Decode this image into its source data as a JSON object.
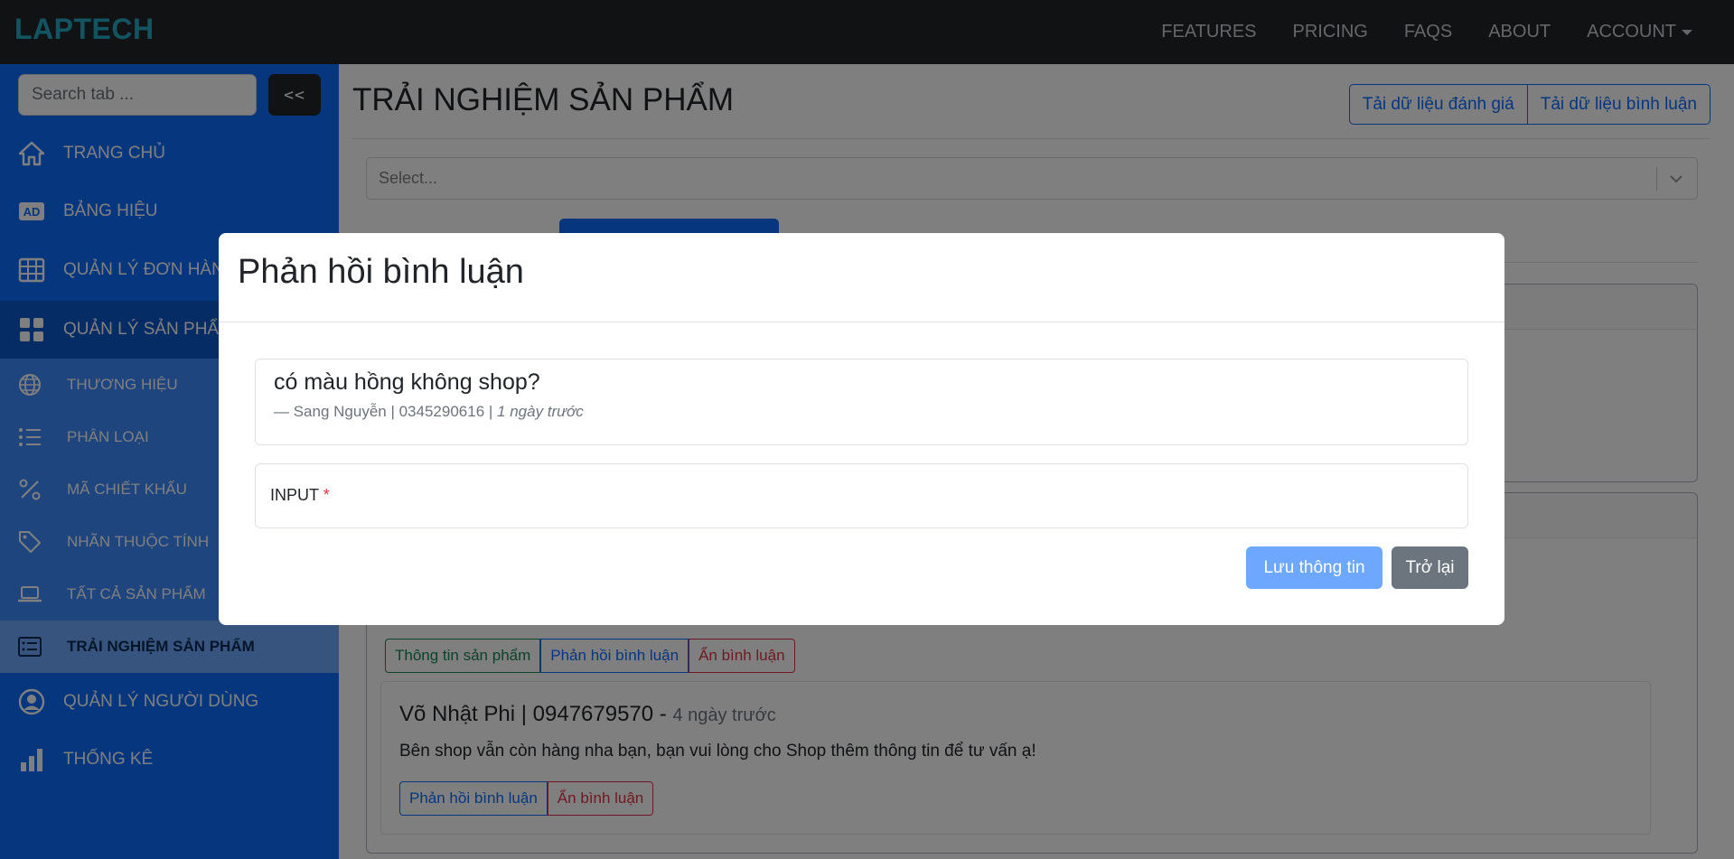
{
  "navbar": {
    "brand": "LAPTECH",
    "links": [
      "FEATURES",
      "PRICING",
      "FAQS",
      "ABOUT",
      "ACCOUNT"
    ]
  },
  "sidebar": {
    "search_placeholder": "Search tab ...",
    "collapse_label": "<<",
    "items": [
      {
        "label": "TRANG CHỦ",
        "icon": "home-icon"
      },
      {
        "label": "BẢNG HIỆU",
        "icon": "ad-icon"
      },
      {
        "label": "QUẢN LÝ ĐƠN HÀNG",
        "icon": "table-icon"
      },
      {
        "label": "QUẢN LÝ SẢN PHẨM",
        "icon": "grid-icon"
      }
    ],
    "sub_items": [
      {
        "label": "THƯƠNG HIỆU",
        "icon": "globe-icon"
      },
      {
        "label": "PHÂN LOẠI",
        "icon": "list-icon"
      },
      {
        "label": "MÃ CHIẾT KHẤU",
        "icon": "percent-icon"
      },
      {
        "label": "NHÃN THUỘC TÍNH",
        "icon": "tag-icon"
      },
      {
        "label": "TẤT CẢ SẢN PHẨM",
        "icon": "laptop-icon"
      },
      {
        "label": "TRẢI NGHIỆM SẢN PHẨM",
        "icon": "card-list-icon"
      }
    ],
    "bottom_items": [
      {
        "label": "QUẢN LÝ NGƯỜI DÙNG",
        "icon": "user-circle-icon"
      },
      {
        "label": "THỐNG KÊ",
        "icon": "bar-chart-icon"
      }
    ]
  },
  "main": {
    "title": "TRẢI NGHIỆM SẢN PHẨM",
    "load_review_data": "Tải dữ liệu đánh giá",
    "load_comment_data": "Tải dữ liệu bình luận",
    "select_placeholder": "Select...",
    "comment_actions": {
      "product_info": "Thông tin sản phẩm",
      "reply": "Phản hồi bình luận",
      "hide": "Ẩn bình luận"
    },
    "reply": {
      "author": "Võ Nhật Phi | 0947679570 -",
      "time": "4 ngày trước",
      "text": "Bên shop vẫn còn hàng nha bạn, bạn vui lòng cho Shop thêm thông tin để tư vấn ạ!",
      "reply_label": "Phản hồi bình luận",
      "hide_label": "Ẩn bình luận"
    }
  },
  "modal": {
    "title": "Phản hồi bình luận",
    "comment": "có màu hồng không shop?",
    "footer_prefix": "— Sang Nguyễn | 0345290616 |",
    "footer_time": "1 ngày trước",
    "input_label": "INPUT",
    "required_mark": "*",
    "save_label": "Lưu thông tin",
    "back_label": "Trở lại"
  }
}
